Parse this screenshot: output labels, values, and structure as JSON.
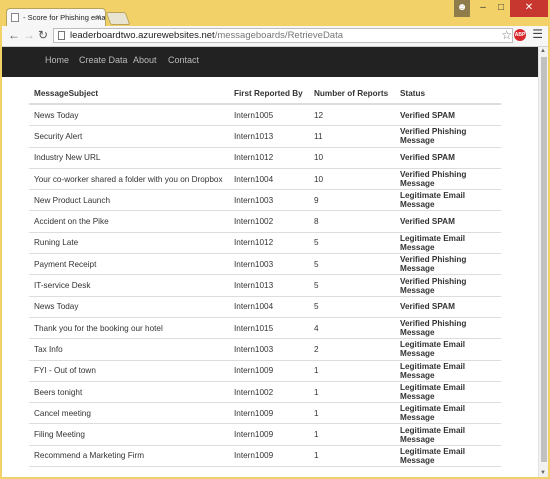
{
  "browser": {
    "tab_title": "- Score for Phishing email",
    "tab_close": "×",
    "url_host": "leaderboardtwo.azurewebsites.net",
    "url_path": "/messageboards/RetrieveData",
    "extension_label": "ABP"
  },
  "nav": {
    "items": [
      "Home",
      "Create Data",
      "About",
      "Contact"
    ]
  },
  "table": {
    "headers": [
      "MessageSubject",
      "First Reported By",
      "Number of Reports",
      "Status"
    ],
    "rows": [
      [
        "News Today",
        "Intern1005",
        "12",
        "Verified SPAM"
      ],
      [
        "Security Alert",
        "Intern1013",
        "11",
        "Verified Phishing Message"
      ],
      [
        "Industry New URL",
        "Intern1012",
        "10",
        "Verified SPAM"
      ],
      [
        "Your co-worker shared a folder with you on Dropbox",
        "Intern1004",
        "10",
        "Verified Phishing Message"
      ],
      [
        "New Product Launch",
        "Intern1003",
        "9",
        "Legitimate Email Message"
      ],
      [
        "Accident on the Pike",
        "Intern1002",
        "8",
        "Verified SPAM"
      ],
      [
        "Runing Late",
        "Intern1012",
        "5",
        "Legitimate Email Message"
      ],
      [
        "Payment Receipt",
        "Intern1003",
        "5",
        "Verified Phishing Message"
      ],
      [
        "IT-service Desk",
        "Intern1013",
        "5",
        "Verified Phishing Message"
      ],
      [
        "News Today",
        "Intern1004",
        "5",
        "Verified SPAM"
      ],
      [
        "Thank you for the booking our hotel",
        "Intern1015",
        "4",
        "Verified Phishing Message"
      ],
      [
        "Tax Info",
        "Intern1003",
        "2",
        "Legitimate Email Message"
      ],
      [
        "FYI - Out of town",
        "Intern1009",
        "1",
        "Legitimate Email Message"
      ],
      [
        "Beers tonight",
        "Intern1002",
        "1",
        "Legitimate Email Message"
      ],
      [
        "Cancel meeting",
        "Intern1009",
        "1",
        "Legitimate Email Message"
      ],
      [
        "Filing Meeting",
        "Intern1009",
        "1",
        "Legitimate Email Message"
      ],
      [
        "Recommend a Marketing Firm",
        "Intern1009",
        "1",
        "Legitimate Email Message"
      ]
    ]
  }
}
